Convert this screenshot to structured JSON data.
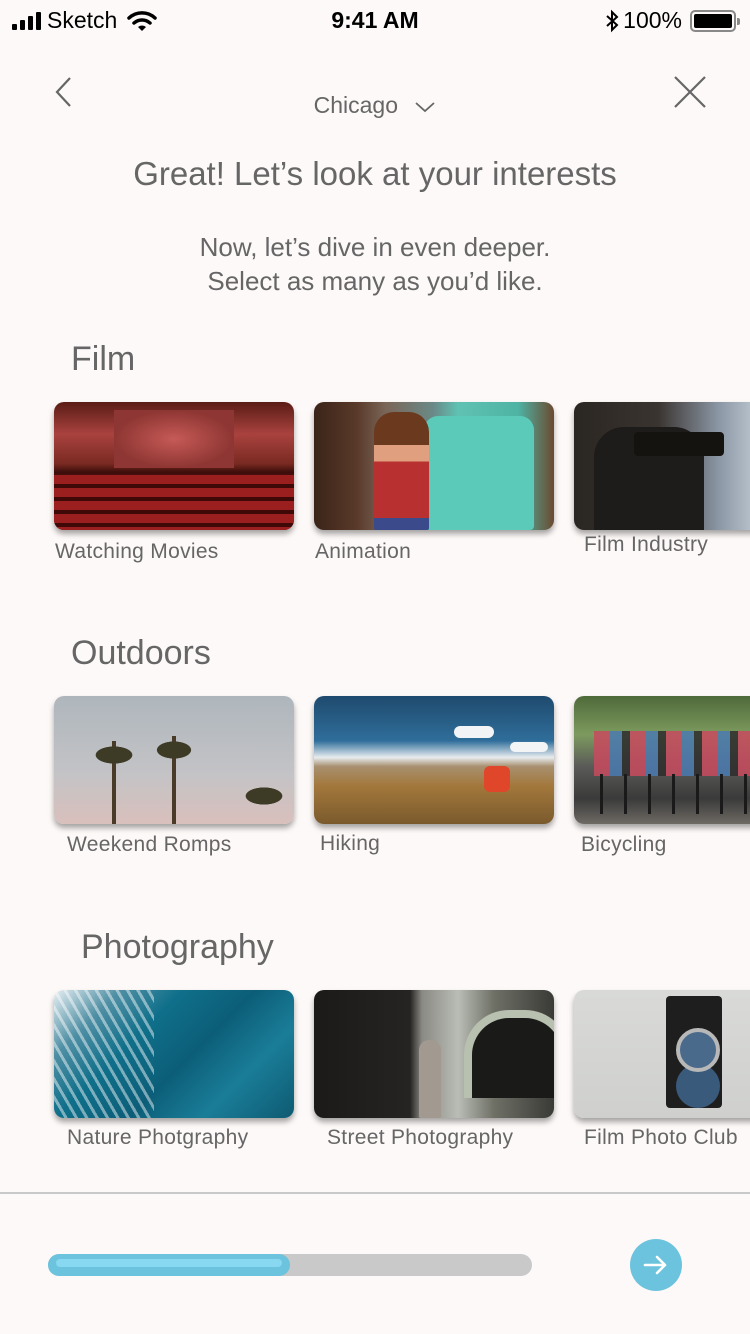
{
  "status_bar": {
    "carrier": "Sketch",
    "time": "9:41 AM",
    "battery_percent": "100%",
    "signal_bars": 4,
    "icons": [
      "signal-icon",
      "wifi-icon",
      "bluetooth-icon",
      "battery-icon"
    ]
  },
  "nav": {
    "back_icon": "chevron-left-icon",
    "close_icon": "close-icon",
    "city": "Chicago",
    "city_dropdown_icon": "chevron-down-icon"
  },
  "header": {
    "title": "Great! Let’s look at your interests",
    "subtitle_line1": "Now, let’s dive in even deeper.",
    "subtitle_line2": "Select  as many as you’d like."
  },
  "sections": [
    {
      "title": "Film",
      "items": [
        {
          "label": "Watching  Movies",
          "image": "movie-theater"
        },
        {
          "label": "Animation",
          "image": "animated-characters"
        },
        {
          "label": "Film Industry",
          "image": "film-camera-crew"
        }
      ]
    },
    {
      "title": "Outdoors",
      "items": [
        {
          "label": "Weekend Romps",
          "image": "palm-trees"
        },
        {
          "label": "Hiking",
          "image": "hikers-mountain"
        },
        {
          "label": "Bicycling",
          "image": "cyclists-group"
        }
      ]
    },
    {
      "title": "Photography",
      "items": [
        {
          "label": "Nature Photgraphy",
          "image": "ocean-waves"
        },
        {
          "label": "Street Photography",
          "image": "street-photographer"
        },
        {
          "label": "Film Photo Club",
          "image": "vintage-camera"
        }
      ]
    }
  ],
  "footer": {
    "progress_percent": 50,
    "next_icon": "arrow-right-icon",
    "accent_color": "#6bc3dd",
    "track_color": "#c9c9c9"
  }
}
